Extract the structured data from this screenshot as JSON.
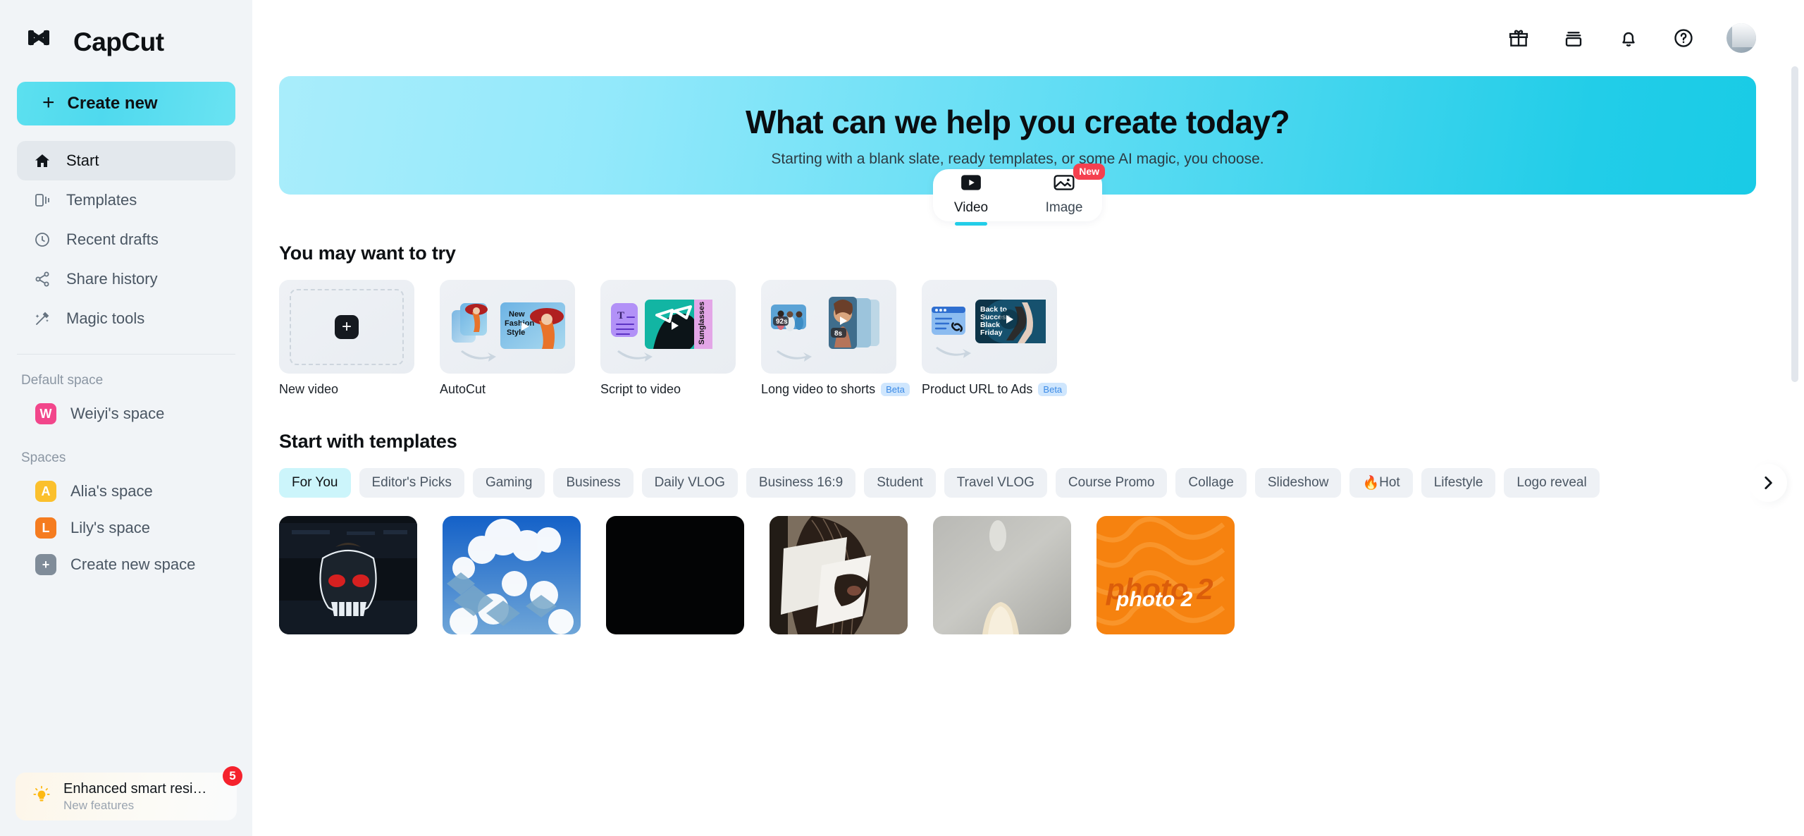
{
  "brand": {
    "name": "CapCut",
    "logo_icon": "capcut-logo-icon"
  },
  "sidebar": {
    "create_new": {
      "label": "Create new",
      "icon": "plus-icon"
    },
    "nav": [
      {
        "label": "Start",
        "icon": "home-icon",
        "active": true
      },
      {
        "label": "Templates",
        "icon": "templates-icon",
        "active": false
      },
      {
        "label": "Recent drafts",
        "icon": "clock-icon",
        "active": false
      },
      {
        "label": "Share history",
        "icon": "share-icon",
        "active": false
      },
      {
        "label": "Magic tools",
        "icon": "magic-wand-icon",
        "active": false
      }
    ],
    "default_space_label": "Default space",
    "default_space": {
      "label": "Weiyi's space",
      "initial": "W",
      "color": "#f2468b"
    },
    "spaces_label": "Spaces",
    "spaces": [
      {
        "label": "Alia's space",
        "initial": "A",
        "color": "#fbc02d"
      },
      {
        "label": "Lily's space",
        "initial": "L",
        "color": "#f57c20"
      },
      {
        "label": "Create new space",
        "initial": "+",
        "color": "#808c99"
      }
    ],
    "promo": {
      "title": "Enhanced smart resi…",
      "subtitle": "New features",
      "badge": "5",
      "icon": "lightbulb-icon",
      "badge_color": "#f5222d"
    }
  },
  "topbar": {
    "icons": [
      {
        "name": "gift-icon"
      },
      {
        "name": "archive-stack-icon"
      },
      {
        "name": "bell-icon"
      },
      {
        "name": "help-circle-icon"
      }
    ],
    "avatar": {
      "name": "user-avatar"
    }
  },
  "hero": {
    "title": "What can we help you create today?",
    "subtitle": "Starting with a blank slate, ready templates, or some AI magic, you choose.",
    "gradient_from": "#a9edfb",
    "gradient_to": "#19cbe6"
  },
  "mode_switch": {
    "tabs": [
      {
        "label": "Video",
        "icon": "video-play-icon",
        "active": true,
        "badge": ""
      },
      {
        "label": "Image",
        "icon": "image-icon",
        "active": false,
        "badge": "New"
      }
    ],
    "accent": "#22cde8",
    "badge_color": "#f5404f"
  },
  "try_section": {
    "title": "You may want to try",
    "cards": [
      {
        "label": "New video",
        "badge": "",
        "thumb": "new-video-placeholder"
      },
      {
        "label": "AutoCut",
        "badge": "",
        "thumb": "autocut-preview",
        "overlay_text": "New Fashion Style"
      },
      {
        "label": "Script to video",
        "badge": "",
        "thumb": "script-to-video-preview",
        "overlay_text": "Sunglasses"
      },
      {
        "label": "Long video to shorts",
        "badge": "Beta",
        "thumb": "long-to-shorts-preview",
        "clip_in": "92s",
        "clip_out": "8s"
      },
      {
        "label": "Product URL to Ads",
        "badge": "Beta",
        "thumb": "product-url-to-ads-preview",
        "overlay_text": "Back to Success Black Friday"
      }
    ]
  },
  "templates_section": {
    "title": "Start with templates",
    "chips": [
      {
        "label": "For You",
        "active": true,
        "emoji": ""
      },
      {
        "label": "Editor's Picks",
        "active": false,
        "emoji": ""
      },
      {
        "label": "Gaming",
        "active": false,
        "emoji": ""
      },
      {
        "label": "Business",
        "active": false,
        "emoji": ""
      },
      {
        "label": "Daily VLOG",
        "active": false,
        "emoji": ""
      },
      {
        "label": "Business 16:9",
        "active": false,
        "emoji": ""
      },
      {
        "label": "Student",
        "active": false,
        "emoji": ""
      },
      {
        "label": "Travel VLOG",
        "active": false,
        "emoji": ""
      },
      {
        "label": "Course Promo",
        "active": false,
        "emoji": ""
      },
      {
        "label": "Collage",
        "active": false,
        "emoji": ""
      },
      {
        "label": "Slideshow",
        "active": false,
        "emoji": ""
      },
      {
        "label": "Hot",
        "active": false,
        "emoji": "🔥"
      },
      {
        "label": "Lifestyle",
        "active": false,
        "emoji": ""
      },
      {
        "label": "Logo reveal",
        "active": false,
        "emoji": ""
      }
    ],
    "next_arrow_icon": "chevron-right-icon",
    "thumbs": [
      {
        "name": "template-skull-stadium",
        "caption_text": ""
      },
      {
        "name": "template-clouds-city",
        "caption_text": ""
      },
      {
        "name": "template-black",
        "caption_text": ""
      },
      {
        "name": "template-portrait-paper",
        "caption_text": ""
      },
      {
        "name": "template-grey-blonde",
        "caption_text": ""
      },
      {
        "name": "template-photo-2-orange",
        "caption_text": "photo 2"
      }
    ]
  }
}
